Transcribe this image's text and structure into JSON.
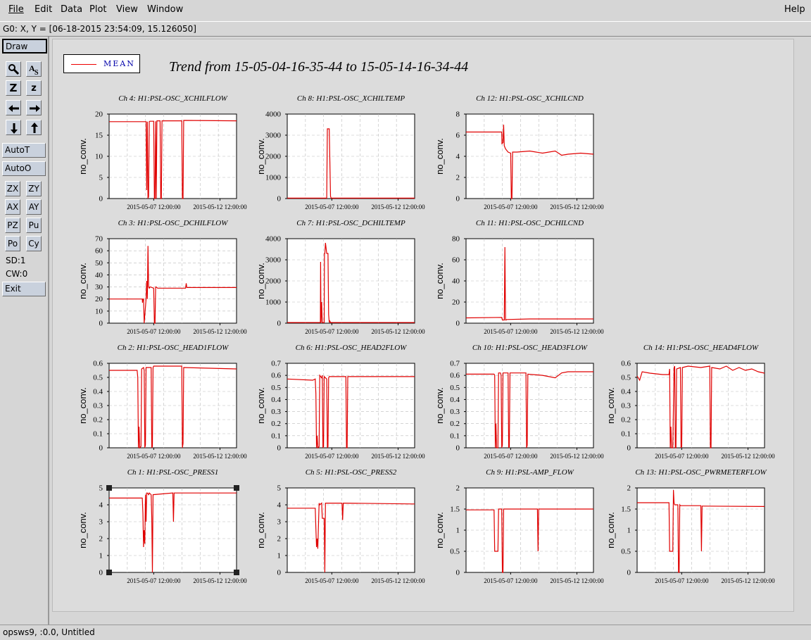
{
  "menus": [
    "File",
    "Edit",
    "Data",
    "Plot",
    "View",
    "Window"
  ],
  "help": "Help",
  "coord": "G0: X, Y = [06-18-2015 23:54:09, 15.126050]",
  "toolbar": {
    "draw": "Draw",
    "zoom_big": "Z",
    "zoom_small": "z",
    "autot": "AutoT",
    "autoo": "AutoO",
    "zx": "ZX",
    "zy": "ZY",
    "ax": "AX",
    "ay": "AY",
    "pz": "PZ",
    "pu": "Pu",
    "po": "Po",
    "cy": "Cy",
    "sd": "SD:1",
    "cw": "CW:0",
    "exit": "Exit"
  },
  "legend": "MEAN",
  "plot_title": "Trend from 15-05-04-16-35-44 to 15-05-14-16-34-44",
  "status": "opsws9, :0.0, Untitled",
  "colors": {
    "trace": "#e00000",
    "legend_text": "#0000aa"
  },
  "chart_data": [
    {
      "type": "line",
      "title": "Ch 4: H1:PSL-OSC_XCHILFLOW",
      "ylabel": "no_conv.",
      "xticks": [
        "2015-05-07 12:00:00",
        "2015-05-12 12:00:00"
      ],
      "xlim": [
        0,
        10
      ],
      "ylim": [
        0,
        20
      ],
      "yticks": [
        0,
        5,
        10,
        15,
        20
      ],
      "x": [
        0,
        2.9,
        2.95,
        3.0,
        3.05,
        3.1,
        3.15,
        3.2,
        3.5,
        3.55,
        3.6,
        3.65,
        3.7,
        3.75,
        4.0,
        4.05,
        4.1,
        4.15,
        5.7,
        5.75,
        5.8,
        5.85,
        10
      ],
      "y": [
        18.2,
        18.2,
        2,
        18.2,
        0,
        0.5,
        18.2,
        18.3,
        18.3,
        0,
        0,
        18.3,
        0,
        18.4,
        18.4,
        0,
        0,
        18.4,
        18.4,
        0,
        0,
        18.5,
        18.4
      ]
    },
    {
      "type": "line",
      "title": "Ch 8: H1:PSL-OSC_XCHILTEMP",
      "ylabel": "no_conv.",
      "xticks": [
        "2015-05-07 12:00:00",
        "2015-05-12 12:00:00"
      ],
      "xlim": [
        0,
        10
      ],
      "ylim": [
        0,
        4000
      ],
      "yticks": [
        0,
        1000,
        2000,
        3000,
        4000
      ],
      "x": [
        0,
        3.1,
        3.15,
        3.2,
        3.3,
        3.4,
        3.45,
        10
      ],
      "y": [
        20,
        20,
        3300,
        3300,
        3300,
        100,
        20,
        20
      ]
    },
    {
      "type": "line",
      "title": "Ch 12: H1:PSL-OSC_XCHILCND",
      "ylabel": "no_conv.",
      "xticks": [
        "2015-05-07 12:00:00",
        "2015-05-12 12:00:00"
      ],
      "xlim": [
        0,
        10
      ],
      "ylim": [
        0,
        8
      ],
      "yticks": [
        0,
        2,
        4,
        6,
        8
      ],
      "x": [
        0,
        2.8,
        2.82,
        2.9,
        2.95,
        3.0,
        3.1,
        3.3,
        3.5,
        3.55,
        3.6,
        3.65,
        4,
        5,
        6,
        7,
        7.5,
        8,
        9,
        10
      ],
      "y": [
        6.3,
        6.3,
        5.2,
        5.3,
        7.0,
        5.0,
        4.7,
        4.4,
        4.3,
        0,
        0,
        4.4,
        4.4,
        4.5,
        4.3,
        4.5,
        4.1,
        4.2,
        4.3,
        4.2
      ]
    },
    {
      "type": "line",
      "title": "Ch 3: H1:PSL-OSC_DCHILFLOW",
      "ylabel": "no_conv.",
      "xticks": [
        "2015-05-07 12:00:00",
        "2015-05-12 12:00:00"
      ],
      "xlim": [
        0,
        10
      ],
      "ylim": [
        0,
        70
      ],
      "yticks": [
        0,
        10,
        20,
        30,
        40,
        50,
        60,
        70
      ],
      "x": [
        0,
        2.6,
        2.62,
        2.65,
        2.7,
        2.75,
        2.9,
        2.95,
        3.0,
        3.05,
        3.1,
        3.15,
        3.2,
        3.25,
        3.5,
        3.55,
        3.6,
        3.65,
        3.7,
        3.8,
        6,
        6.05,
        6.1,
        10
      ],
      "y": [
        20,
        20,
        17,
        20,
        20,
        0,
        20,
        35,
        20,
        64,
        30,
        29,
        30,
        30,
        29,
        0,
        0,
        30,
        30,
        29,
        29,
        33,
        29.5,
        29.5
      ]
    },
    {
      "type": "line",
      "title": "Ch 7: H1:PSL-OSC_DCHILTEMP",
      "ylabel": "no_conv.",
      "xticks": [
        "2015-05-07 12:00:00",
        "2015-05-12 12:00:00"
      ],
      "xlim": [
        0,
        10
      ],
      "ylim": [
        0,
        4000
      ],
      "yticks": [
        0,
        1000,
        2000,
        3000,
        4000
      ],
      "x": [
        0,
        2.6,
        2.62,
        2.65,
        2.7,
        2.75,
        2.9,
        2.92,
        2.95,
        3.0,
        3.1,
        3.15,
        3.2,
        3.25,
        3.3,
        3.35,
        3.4,
        3.5,
        10
      ],
      "y": [
        30,
        30,
        2900,
        30,
        1000,
        30,
        30,
        3300,
        3300,
        3800,
        3300,
        3300,
        3300,
        400,
        30,
        100,
        30,
        30,
        30
      ]
    },
    {
      "type": "line",
      "title": "Ch 11: H1:PSL-OSC_DCHILCND",
      "ylabel": "no_conv.",
      "xticks": [
        "2015-05-07 12:00:00",
        "2015-05-12 12:00:00"
      ],
      "xlim": [
        0,
        10
      ],
      "ylim": [
        0,
        80
      ],
      "yticks": [
        0,
        20,
        40,
        60,
        80
      ],
      "x": [
        0,
        2.8,
        2.85,
        3.0,
        3.05,
        3.1,
        3.15,
        3.2,
        5,
        6,
        10
      ],
      "y": [
        5,
        5.5,
        3,
        3,
        72,
        3,
        3,
        3.5,
        4,
        4,
        4
      ]
    },
    {
      "type": "line",
      "title": "Ch 2: H1:PSL-OSC_HEAD1FLOW",
      "ylabel": "no_conv.",
      "xticks": [
        "2015-05-07 12:00:00",
        "2015-05-12 12:00:00"
      ],
      "xlim": [
        0,
        10
      ],
      "ylim": [
        0,
        0.6
      ],
      "yticks": [
        0,
        0.1,
        0.2,
        0.3,
        0.4,
        0.5,
        0.6
      ],
      "x": [
        0,
        2.2,
        2.25,
        2.3,
        2.35,
        2.4,
        2.5,
        2.55,
        2.7,
        2.75,
        2.8,
        2.85,
        2.9,
        3.3,
        3.35,
        3.4,
        3.45,
        3.5,
        5.7,
        5.75,
        5.8,
        5.85,
        10
      ],
      "y": [
        0.55,
        0.55,
        0.5,
        0,
        0.15,
        0,
        0.01,
        0.56,
        0.57,
        0.55,
        0,
        0.02,
        0.57,
        0.57,
        0,
        0.01,
        0.57,
        0.58,
        0.58,
        0,
        0.03,
        0.57,
        0.56
      ]
    },
    {
      "type": "line",
      "title": "Ch 6: H1:PSL-OSC_HEAD2FLOW",
      "ylabel": "no_conv.",
      "xticks": [
        "2015-05-07 12:00:00",
        "2015-05-12 12:00:00"
      ],
      "xlim": [
        0,
        10
      ],
      "ylim": [
        0,
        0.7
      ],
      "yticks": [
        0,
        0.1,
        0.2,
        0.3,
        0.4,
        0.5,
        0.6,
        0.7
      ],
      "x": [
        0,
        2.0,
        2.2,
        2.25,
        2.3,
        2.35,
        2.4,
        2.5,
        2.55,
        2.7,
        2.75,
        2.8,
        2.85,
        2.9,
        3.1,
        3.15,
        3.2,
        3.25,
        3.3,
        4.6,
        4.65,
        4.7,
        4.75,
        10
      ],
      "y": [
        0.57,
        0.56,
        0.57,
        0.45,
        0,
        0.1,
        0,
        0.01,
        0.6,
        0.58,
        0.6,
        0,
        0.01,
        0.59,
        0.57,
        0,
        0.01,
        0.58,
        0.59,
        0.59,
        0,
        0,
        0.59,
        0.59
      ]
    },
    {
      "type": "line",
      "title": "Ch 10: H1:PSL-OSC_HEAD3FLOW",
      "ylabel": "no_conv.",
      "xticks": [
        "2015-05-07 12:00:00",
        "2015-05-12 12:00:00"
      ],
      "xlim": [
        0,
        10
      ],
      "ylim": [
        0,
        0.7
      ],
      "yticks": [
        0,
        0.1,
        0.2,
        0.3,
        0.4,
        0.5,
        0.6,
        0.7
      ],
      "x": [
        0,
        2.2,
        2.25,
        2.3,
        2.35,
        2.4,
        2.5,
        2.55,
        2.7,
        2.75,
        2.8,
        2.85,
        2.9,
        3.3,
        3.35,
        3.4,
        3.45,
        4.7,
        4.75,
        4.8,
        4.85,
        6,
        7,
        7.5,
        8,
        10
      ],
      "y": [
        0.61,
        0.61,
        0.6,
        0,
        0.2,
        0,
        0,
        0.62,
        0.62,
        0.6,
        0,
        0.02,
        0.62,
        0.62,
        0,
        0.01,
        0.62,
        0.62,
        0,
        0.02,
        0.61,
        0.6,
        0.58,
        0.62,
        0.63,
        0.63
      ]
    },
    {
      "type": "line",
      "title": "Ch 14: H1:PSL-OSC_HEAD4FLOW",
      "ylabel": "no_conv.",
      "xticks": [
        "2015-05-07 12:00:00",
        "2015-05-12 12:00:00"
      ],
      "xlim": [
        0,
        10
      ],
      "ylim": [
        0,
        0.6
      ],
      "yticks": [
        0,
        0.1,
        0.2,
        0.3,
        0.4,
        0.5,
        0.6
      ],
      "x": [
        0,
        0.2,
        0.4,
        1,
        2,
        2.5,
        2.55,
        2.6,
        2.65,
        2.7,
        2.8,
        2.9,
        2.95,
        3.0,
        3.05,
        3.1,
        3.4,
        3.45,
        3.5,
        3.55,
        4,
        5,
        5.7,
        5.75,
        5.8,
        5.85,
        6.5,
        7,
        7.5,
        8,
        8.5,
        9,
        9.5,
        10
      ],
      "y": [
        0.51,
        0.48,
        0.54,
        0.53,
        0.52,
        0.52,
        0.56,
        0,
        0.15,
        0,
        0,
        0.57,
        0.58,
        0,
        0,
        0.56,
        0.57,
        0,
        0.01,
        0.57,
        0.58,
        0.57,
        0.58,
        0,
        0,
        0.57,
        0.56,
        0.58,
        0.55,
        0.57,
        0.55,
        0.56,
        0.54,
        0.53
      ]
    },
    {
      "type": "line",
      "title": "Ch 1: H1:PSL-OSC_PRESS1",
      "ylabel": "no_conv.",
      "xticks": [
        "2015-05-07 12:00:00",
        "2015-05-12 12:00:00"
      ],
      "xlim": [
        0,
        10
      ],
      "ylim": [
        0,
        5
      ],
      "yticks": [
        0,
        1,
        2,
        3,
        4,
        5
      ],
      "x": [
        0,
        2.6,
        2.65,
        2.7,
        2.75,
        2.8,
        2.85,
        2.9,
        2.95,
        3.0,
        3.1,
        3.15,
        3.3,
        3.35,
        3.4,
        3.45,
        5.0,
        5.05,
        5.1,
        5.15,
        10
      ],
      "y": [
        4.4,
        4.4,
        3.5,
        1.5,
        2.5,
        1.7,
        4.6,
        3.0,
        4.7,
        4.7,
        4.6,
        4.7,
        4.6,
        3.2,
        0,
        4.6,
        4.7,
        3.0,
        4.7,
        4.7,
        4.7
      ]
    },
    {
      "type": "line",
      "title": "Ch 5: H1:PSL-OSC_PRESS2",
      "ylabel": "no_conv.",
      "xticks": [
        "2015-05-07 12:00:00",
        "2015-05-12 12:00:00"
      ],
      "xlim": [
        0,
        10
      ],
      "ylim": [
        0,
        5
      ],
      "yticks": [
        0,
        1,
        2,
        3,
        4,
        5
      ],
      "x": [
        0,
        2.2,
        2.25,
        2.3,
        2.35,
        2.4,
        2.5,
        2.55,
        2.7,
        2.75,
        2.9,
        2.95,
        3.0,
        3.05,
        3.1,
        4.3,
        4.35,
        4.4,
        4.45,
        10
      ],
      "y": [
        3.8,
        3.8,
        2.6,
        1.5,
        2.0,
        1.4,
        4.1,
        4.0,
        4.1,
        3.2,
        3.2,
        0,
        4.1,
        4.1,
        4.1,
        4.1,
        3.1,
        4.1,
        4.1,
        4.05
      ]
    },
    {
      "type": "line",
      "title": "Ch 9: H1:PSL-AMP_FLOW",
      "ylabel": "no_conv.",
      "xticks": [
        "2015-05-07 12:00:00",
        "2015-05-12 12:00:00"
      ],
      "xlim": [
        0,
        10
      ],
      "ylim": [
        0,
        2
      ],
      "yticks": [
        0,
        0.5,
        1,
        1.5,
        2
      ],
      "x": [
        0,
        2.2,
        2.25,
        2.3,
        2.5,
        2.55,
        2.6,
        2.65,
        2.8,
        2.85,
        2.9,
        2.95,
        3.0,
        5.6,
        5.65,
        5.7,
        5.75,
        10
      ],
      "y": [
        1.48,
        1.48,
        0.5,
        0.5,
        0.5,
        1.5,
        1.5,
        1.5,
        1.5,
        0,
        0,
        1.5,
        1.5,
        1.5,
        0.5,
        1.5,
        1.5,
        1.5
      ]
    },
    {
      "type": "line",
      "title": "Ch 13: H1:PSL-OSC_PWRMETERFLOW",
      "ylabel": "no_conv.",
      "xticks": [
        "2015-05-07 12:00:00",
        "2015-05-12 12:00:00"
      ],
      "xlim": [
        0,
        10
      ],
      "ylim": [
        0,
        2
      ],
      "yticks": [
        0,
        0.5,
        1,
        1.5,
        2
      ],
      "x": [
        0,
        2.5,
        2.55,
        2.6,
        2.8,
        2.85,
        2.9,
        2.95,
        3.0,
        3.2,
        3.25,
        3.3,
        3.35,
        3.4,
        5.0,
        5.05,
        5.1,
        5.15,
        10
      ],
      "y": [
        1.65,
        1.65,
        0.5,
        0.5,
        0.5,
        1.95,
        1.65,
        1.6,
        1.6,
        1.6,
        0,
        0,
        1.6,
        1.58,
        1.58,
        0.5,
        1.57,
        1.57,
        1.56
      ]
    }
  ]
}
